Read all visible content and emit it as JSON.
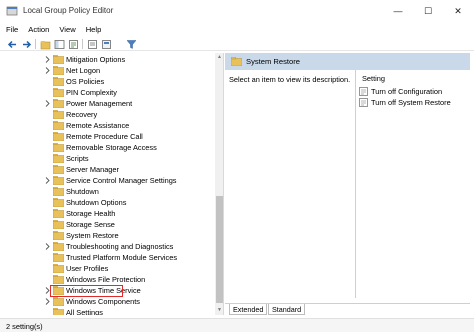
{
  "window": {
    "title": "Local Group Policy Editor",
    "minimize_glyph": "—",
    "maximize_glyph": "☐",
    "close_glyph": "✕"
  },
  "menu": [
    "File",
    "Action",
    "View",
    "Help"
  ],
  "toolbar_icons": [
    "back-icon",
    "forward-icon",
    "folder-up-icon",
    "show-hide-tree-icon",
    "export-list-icon",
    "help-icon",
    "properties-icon",
    "filter-icon"
  ],
  "tree": {
    "items": [
      {
        "label": "Mitigation Options",
        "expandable": true
      },
      {
        "label": "Net Logon",
        "expandable": true
      },
      {
        "label": "OS Policies",
        "expandable": false
      },
      {
        "label": "PIN Complexity",
        "expandable": false
      },
      {
        "label": "Power Management",
        "expandable": true
      },
      {
        "label": "Recovery",
        "expandable": false
      },
      {
        "label": "Remote Assistance",
        "expandable": false
      },
      {
        "label": "Remote Procedure Call",
        "expandable": false
      },
      {
        "label": "Removable Storage Access",
        "expandable": false
      },
      {
        "label": "Scripts",
        "expandable": false
      },
      {
        "label": "Server Manager",
        "expandable": false
      },
      {
        "label": "Service Control Manager Settings",
        "expandable": true
      },
      {
        "label": "Shutdown",
        "expandable": false
      },
      {
        "label": "Shutdown Options",
        "expandable": false
      },
      {
        "label": "Storage Health",
        "expandable": false
      },
      {
        "label": "Storage Sense",
        "expandable": false
      },
      {
        "label": "System Restore",
        "expandable": false,
        "selected": true
      },
      {
        "label": "Troubleshooting and Diagnostics",
        "expandable": true
      },
      {
        "label": "Trusted Platform Module Services",
        "expandable": false
      },
      {
        "label": "User Profiles",
        "expandable": false
      },
      {
        "label": "Windows File Protection",
        "expandable": false
      },
      {
        "label": "Windows Time Service",
        "expandable": true
      },
      {
        "label": "Windows Components",
        "expandable": true
      },
      {
        "label": "All Settings",
        "expandable": false
      }
    ]
  },
  "details": {
    "header_title": "System Restore",
    "description": "Select an item to view its description.",
    "column_header": "Setting",
    "settings": [
      {
        "label": "Turn off Configuration"
      },
      {
        "label": "Turn off System Restore"
      }
    ],
    "tabs": [
      "Extended",
      "Standard"
    ]
  },
  "status": {
    "text": "2 setting(s)"
  },
  "colors": {
    "header_bg": "#c9d9ea",
    "folder": "#e8c15a",
    "selection_outline": "#e02b2b"
  }
}
